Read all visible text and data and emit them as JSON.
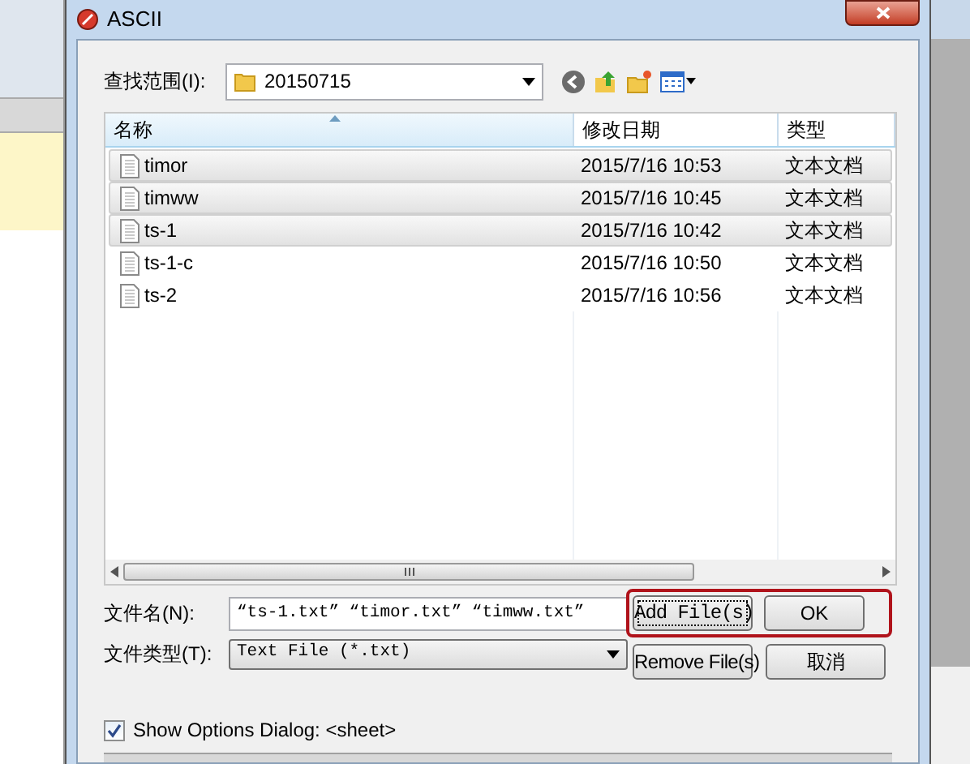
{
  "window": {
    "title": "ASCII"
  },
  "look_in": {
    "label": "查找范围(I):",
    "value": "20150715"
  },
  "columns": [
    {
      "label": "名称",
      "sorted": true
    },
    {
      "label": "修改日期",
      "sorted": false
    },
    {
      "label": "类型",
      "sorted": false
    }
  ],
  "files": [
    {
      "name": "timor",
      "date": "2015/7/16 10:53",
      "type": "文本文档",
      "selected": true
    },
    {
      "name": "timww",
      "date": "2015/7/16 10:45",
      "type": "文本文档",
      "selected": true
    },
    {
      "name": "ts-1",
      "date": "2015/7/16 10:42",
      "type": "文本文档",
      "selected": true
    },
    {
      "name": "ts-1-c",
      "date": "2015/7/16 10:50",
      "type": "文本文档",
      "selected": false
    },
    {
      "name": "ts-2",
      "date": "2015/7/16 10:56",
      "type": "文本文档",
      "selected": false
    }
  ],
  "file_name": {
    "label": "文件名(N):",
    "value": "“ts-1.txt” “timor.txt” “timww.txt”"
  },
  "file_type": {
    "label": "文件类型(T):",
    "value": "Text File (*.txt)"
  },
  "primary_buttons": {
    "highlighted": true,
    "items": [
      {
        "label": "Add File(s)",
        "focused": true
      },
      {
        "label": "OK",
        "focused": false
      }
    ]
  },
  "secondary_buttons": [
    {
      "label": "Remove File(s)"
    },
    {
      "label": "取消"
    }
  ],
  "show_options": {
    "label": "Show Options Dialog: <sheet>",
    "checked": true
  }
}
